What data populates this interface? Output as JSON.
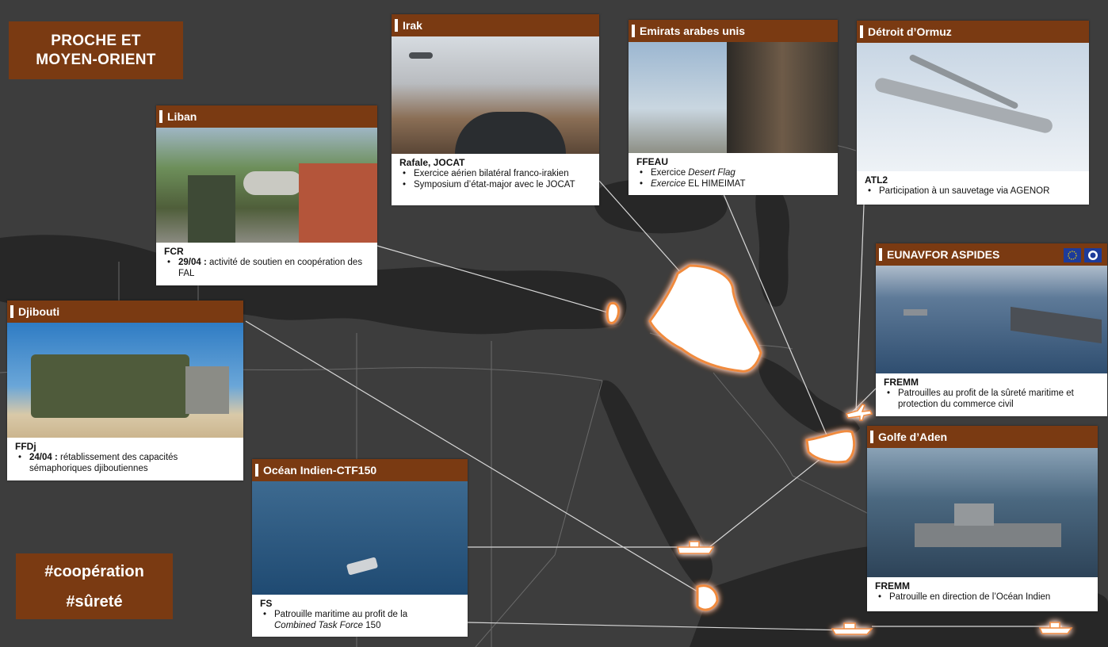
{
  "title": {
    "line1": "PROCHE ET",
    "line2": "MOYEN-ORIENT"
  },
  "tags": {
    "t1": "#coopération",
    "t2": "#sûreté"
  },
  "colors": {
    "brown": "#7a3a12",
    "land": "#4b4b4b",
    "sea": "#2f2f2f",
    "highlight": "#ffffff",
    "glow": "#f08a3c"
  },
  "cards": {
    "liban": {
      "title": "Liban",
      "unit": "FCR",
      "b1_bold": "29/04 :",
      "b1": " activité de soutien en coopération des FAL"
    },
    "irak": {
      "title": "Irak",
      "unit": "Rafale, JOCAT",
      "b1": "Exercice aérien bilatéral franco-irakien",
      "b2": "Symposium d’état-major avec le JOCAT"
    },
    "eau": {
      "title": "Emirats arabes unis",
      "unit": "FFEAU",
      "b1a": "Exercice ",
      "b1b": "Desert Flag",
      "b2a": "Exercice",
      "b2b": " EL HIMEIMAT"
    },
    "ormuz": {
      "title": "Détroit d’Ormuz",
      "unit": "ATL2",
      "b1": "Participation à un sauvetage via AGENOR"
    },
    "aspides": {
      "title": "EUNAVFOR ASPIDES",
      "unit": "FREMM",
      "b1": "Patrouilles au profit de la sûreté maritime et protection du commerce civil"
    },
    "djibouti": {
      "title": "Djibouti",
      "unit": "FFDj",
      "b1_bold": "24/04 :",
      "b1": " rétablissement des capacités sémaphoriques djiboutiennes"
    },
    "ocean": {
      "title": "Océan Indien-CTF150",
      "unit": "FS",
      "b1": "Patrouille maritime au profit de la",
      "b1b": "Combined Task Force",
      "b1c": " 150"
    },
    "aden": {
      "title": "Golfe d’Aden",
      "unit": "FREMM",
      "b1": "Patrouille en direction de l’Océan Indien"
    }
  },
  "icons": [
    "eu-flag-icon",
    "emblem-icon",
    "aircraft-icon",
    "ship-icon"
  ]
}
